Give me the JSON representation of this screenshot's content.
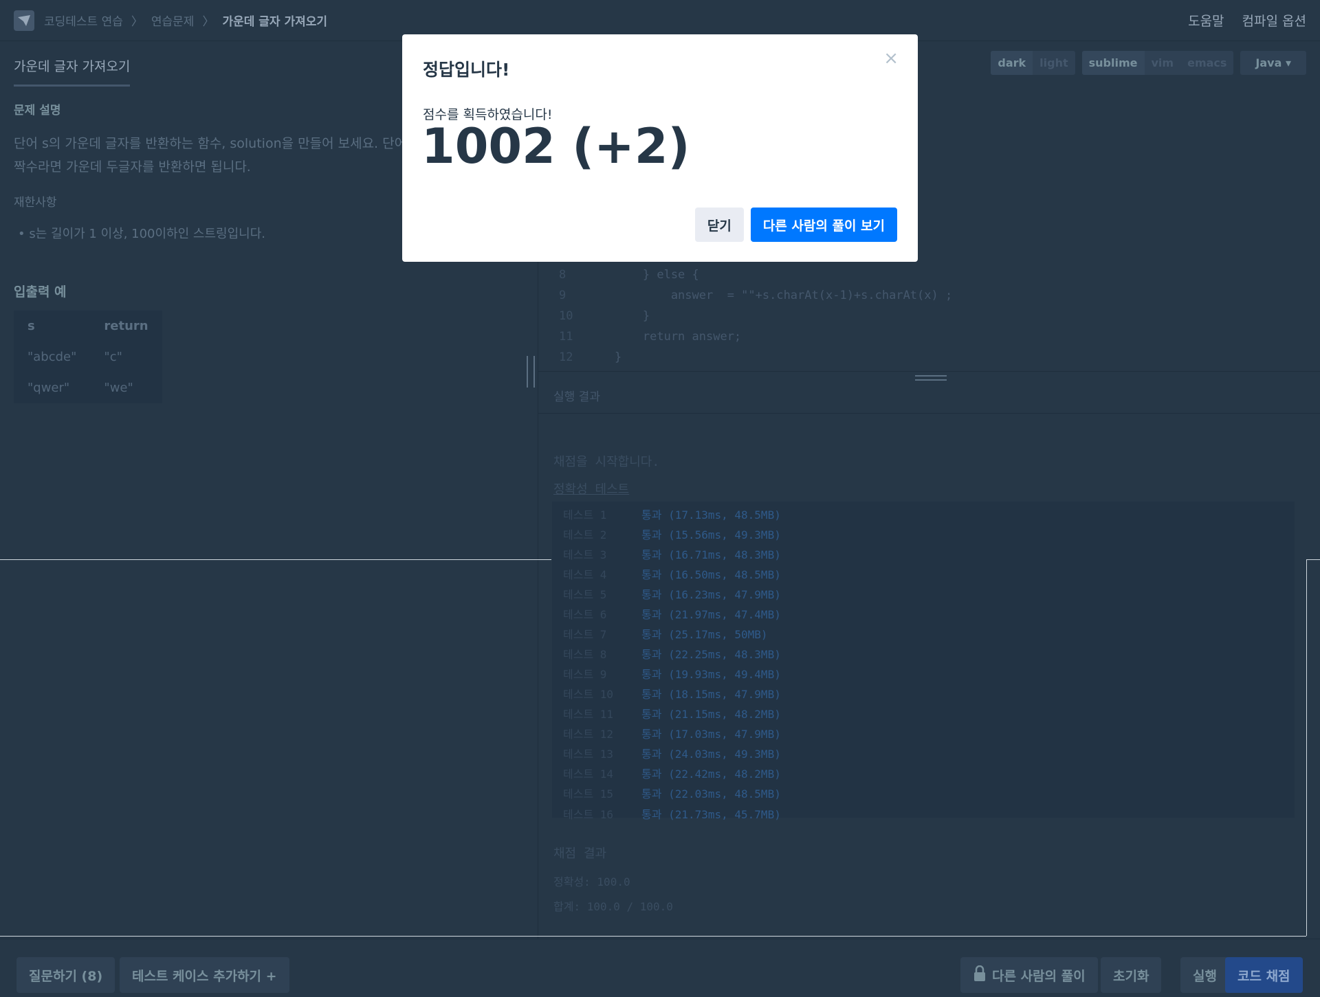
{
  "nav": {
    "crumb1": "코딩테스트 연습",
    "crumb2": "연습문제",
    "crumb3": "가운데 글자 가져오기",
    "help": "도움말",
    "compile_opts": "컴파일 옵션"
  },
  "problem": {
    "tab": "가운데 글자 가져오기",
    "desc_heading": "문제 설명",
    "desc_line1": "단어 s의 가운데 글자를 반환하는 함수, solution을 만들어 보세요. 단어",
    "desc_line2": "짝수라면 가운데 두글자를 반환하면 됩니다.",
    "constraints_heading": "재한사항",
    "constraint1": "s는 길이가 1 이상, 100이하인 스트링입니다.",
    "io_heading": "입출력 예",
    "io_cols": [
      "s",
      "return"
    ],
    "io_rows": [
      [
        "\"abcde\"",
        "\"c\""
      ],
      [
        "\"qwer\"",
        "\"we\""
      ]
    ]
  },
  "editor": {
    "theme_dark": "dark",
    "theme_light": "light",
    "keymap_sublime": "sublime",
    "keymap_vim": "vim",
    "keymap_emacs": "emacs",
    "language": "Java ▾",
    "code_lines": [
      {
        "n": "8",
        "t": "        } else {"
      },
      {
        "n": "9",
        "t": "            answer  = \"\"+s.charAt(x-1)+s.charAt(x) ;"
      },
      {
        "n": "10",
        "t": "        }"
      },
      {
        "n": "11",
        "t": "        return answer;"
      },
      {
        "n": "12",
        "t": "    }"
      }
    ]
  },
  "results": {
    "heading": "실행 결과",
    "start": "채점을 시작합니다.",
    "accuracy_label": "정확성  테스트",
    "tests": [
      {
        "name": "테스트 1",
        "result": "통과 (17.13ms, 48.5MB)"
      },
      {
        "name": "테스트 2",
        "result": "통과 (15.56ms, 49.3MB)"
      },
      {
        "name": "테스트 3",
        "result": "통과 (16.71ms, 48.3MB)"
      },
      {
        "name": "테스트 4",
        "result": "통과 (16.50ms, 48.5MB)"
      },
      {
        "name": "테스트 5",
        "result": "통과 (16.23ms, 47.9MB)"
      },
      {
        "name": "테스트 6",
        "result": "통과 (21.97ms, 47.4MB)"
      },
      {
        "name": "테스트 7",
        "result": "통과 (25.17ms, 50MB)"
      },
      {
        "name": "테스트 8",
        "result": "통과 (22.25ms, 48.3MB)"
      },
      {
        "name": "테스트 9",
        "result": "통과 (19.93ms, 49.4MB)"
      },
      {
        "name": "테스트 10",
        "result": "통과 (18.15ms, 47.9MB)"
      },
      {
        "name": "테스트 11",
        "result": "통과 (21.15ms, 48.2MB)"
      },
      {
        "name": "테스트 12",
        "result": "통과 (17.03ms, 47.9MB)"
      },
      {
        "name": "테스트 13",
        "result": "통과 (24.03ms, 49.3MB)"
      },
      {
        "name": "테스트 14",
        "result": "통과 (22.42ms, 48.2MB)"
      },
      {
        "name": "테스트 15",
        "result": "통과 (22.03ms, 48.5MB)"
      },
      {
        "name": "테스트 16",
        "result": "통과 (21.73ms, 45.7MB)"
      }
    ],
    "summary_heading": "채점 결과",
    "accuracy": "정확성: 100.0",
    "total": "합계: 100.0 / 100.0"
  },
  "bottom": {
    "question": "질문하기 (8)",
    "add_testcase": "테스트 케이스 추가하기 +",
    "others": "다른 사람의 풀이",
    "reset": "초기화",
    "run": "실행",
    "submit": "코드 채점"
  },
  "modal": {
    "title": "정답입니다!",
    "close_x": "×",
    "subtitle": "점수를 획득하였습니다!",
    "score": "1002 (+2)",
    "close_btn": "닫기",
    "others_btn": "다른 사람의 풀이 보기"
  }
}
